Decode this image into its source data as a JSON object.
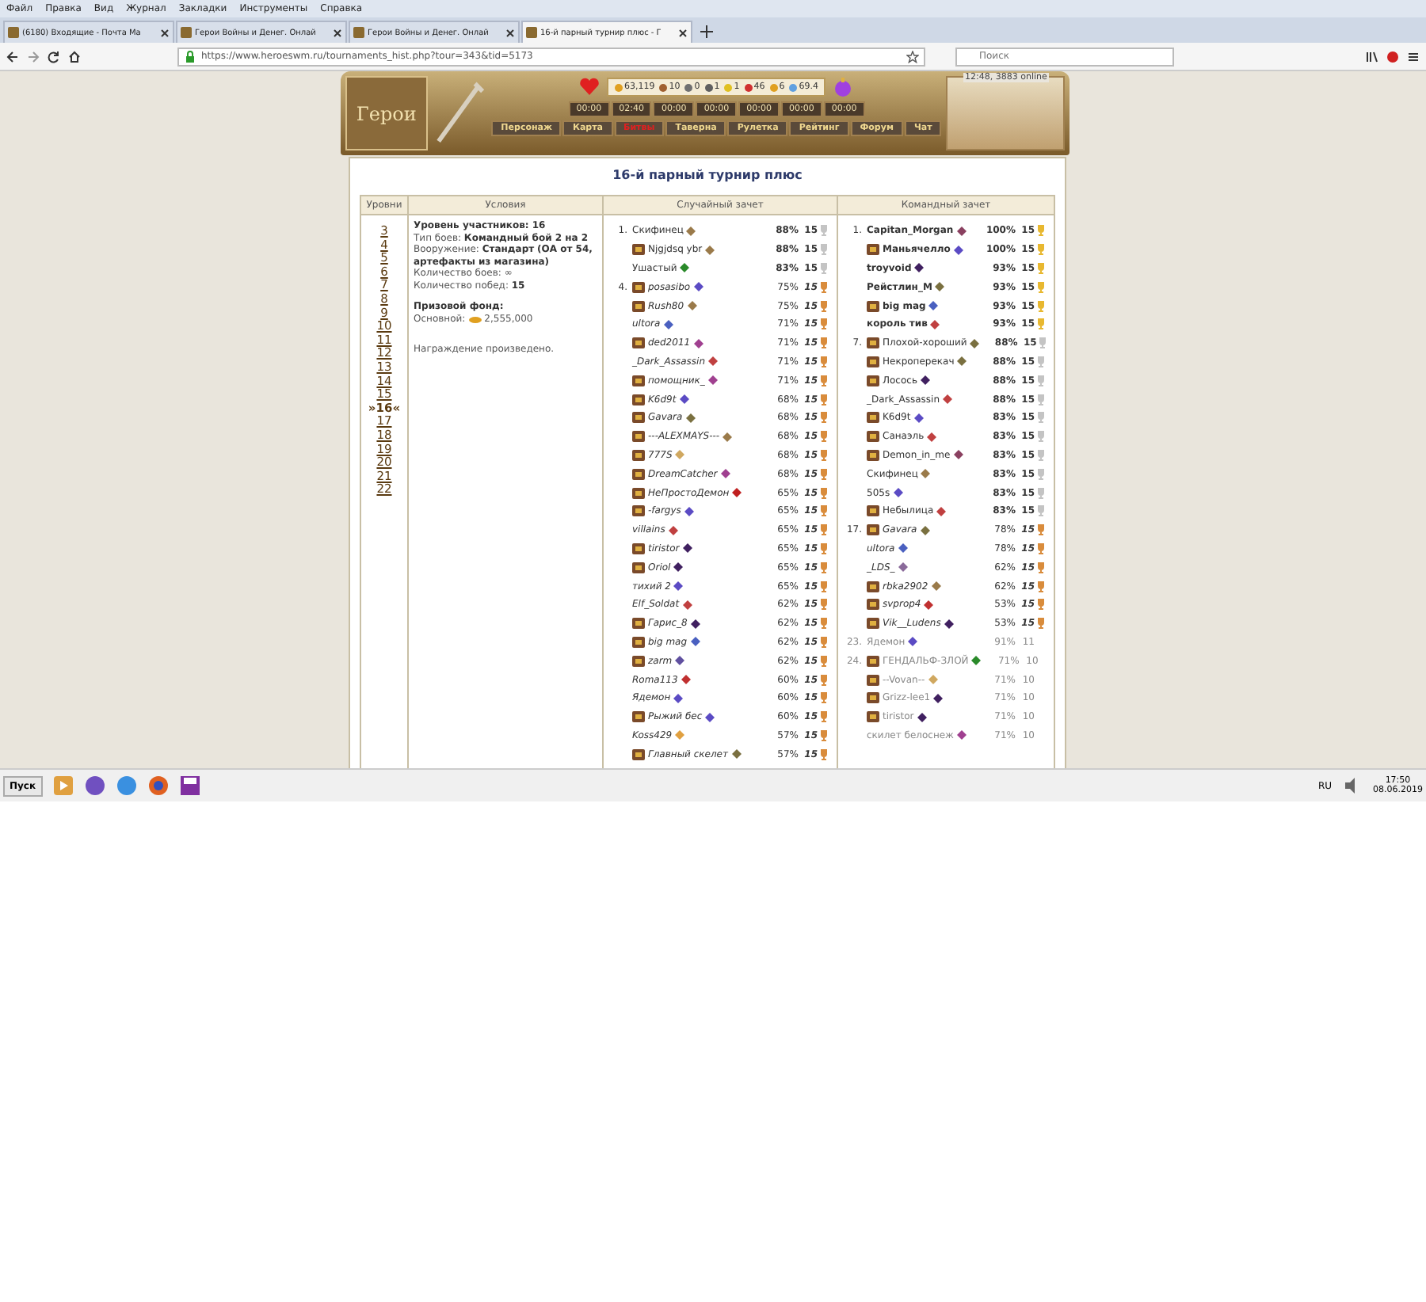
{
  "browser": {
    "menu": [
      "Файл",
      "Правка",
      "Вид",
      "Журнал",
      "Закладки",
      "Инструменты",
      "Справка"
    ],
    "tabs": [
      {
        "title": "(6180) Входящие - Почта Ма",
        "selected": false
      },
      {
        "title": "Герои Войны и Денег. Онлай",
        "selected": false
      },
      {
        "title": "Герои Войны и Денег. Онлай",
        "selected": false
      },
      {
        "title": "16-й парный турнир плюс - Г",
        "selected": true
      }
    ],
    "url": "https://www.heroeswm.ru/tournaments_hist.php?tour=343&tid=5173",
    "search": {
      "placeholder": "Поиск"
    }
  },
  "header": {
    "logo": "Герои",
    "online": "12:48, 3883 online",
    "stats": [
      "63,119",
      "10",
      "0",
      "1",
      "1",
      "46",
      "6",
      "69.4"
    ],
    "timers": [
      "00:00",
      "02:40",
      "00:00",
      "00:00",
      "00:00",
      "00:00",
      "00:00"
    ],
    "nav": [
      {
        "label": "Персонаж",
        "selected": false
      },
      {
        "label": "Карта",
        "selected": false
      },
      {
        "label": "Битвы",
        "selected": true
      },
      {
        "label": "Таверна",
        "selected": false
      },
      {
        "label": "Рулетка",
        "selected": false
      },
      {
        "label": "Рейтинг",
        "selected": false
      },
      {
        "label": "Форум",
        "selected": false
      },
      {
        "label": "Чат",
        "selected": false
      }
    ]
  },
  "title": "16-й парный турнир плюс",
  "table": {
    "columns": [
      "Уровни",
      "Условия",
      "Случайный зачет",
      "Командный зачет"
    ],
    "levels": [
      {
        "label": "3",
        "selected": false
      },
      {
        "label": "4",
        "selected": false
      },
      {
        "label": "5",
        "selected": false
      },
      {
        "label": "6",
        "selected": false
      },
      {
        "label": "7",
        "selected": false
      },
      {
        "label": "8",
        "selected": false
      },
      {
        "label": "9",
        "selected": false
      },
      {
        "label": "10",
        "selected": false
      },
      {
        "label": "11",
        "selected": false
      },
      {
        "label": "12",
        "selected": false
      },
      {
        "label": "13",
        "selected": false
      },
      {
        "label": "14",
        "selected": false
      },
      {
        "label": "15",
        "selected": false
      },
      {
        "label": "»16«",
        "selected": true
      },
      {
        "label": "17",
        "selected": false
      },
      {
        "label": "18",
        "selected": false
      },
      {
        "label": "19",
        "selected": false
      },
      {
        "label": "20",
        "selected": false
      },
      {
        "label": "21",
        "selected": false
      },
      {
        "label": "22",
        "selected": false
      }
    ],
    "conditions": [
      "**Уровень участников: 16**",
      "Тип боев: **Командный бой 2 на 2**",
      "Вооружение: **Стандарт** **(ОА от 54, артефакты из магазина)**",
      "Количество боев: ∞",
      "Количество побед: **15**"
    ],
    "prize_title": "Призовой фонд:",
    "prize_label": "Основной:",
    "prize_amount": "2,555,000",
    "note": "Награждение произведено.",
    "random": [
      {
        "place": "1.",
        "name": "Скифинец",
        "emblem": false,
        "color": "#9a7a4a",
        "percent": "88%",
        "wins": "15",
        "kind": "silver"
      },
      {
        "name": "Njgjdsq ybr",
        "emblem": true,
        "color": "#9a7a4a",
        "percent": "88%",
        "wins": "15",
        "kind": "silver"
      },
      {
        "name": "Ушастый",
        "emblem": false,
        "color": "#2a8a2a",
        "percent": "83%",
        "wins": "15",
        "kind": "silver"
      },
      {
        "place": "4.",
        "name": "posasibo",
        "emblem": true,
        "color": "#5b4bc4",
        "percent": "75%",
        "wins": "15",
        "kind": "bronze"
      },
      {
        "name": "Rush80",
        "emblem": true,
        "color": "#9a7a4a",
        "percent": "75%",
        "wins": "15",
        "kind": "bronze"
      },
      {
        "name": "ultora",
        "emblem": false,
        "color": "#4a60c0",
        "percent": "71%",
        "wins": "15",
        "kind": "bronze"
      },
      {
        "name": "ded2011",
        "emblem": true,
        "color": "#a04090",
        "percent": "71%",
        "wins": "15",
        "kind": "bronze"
      },
      {
        "name": "_Dark_Assassin",
        "emblem": false,
        "color": "#c04040",
        "percent": "71%",
        "wins": "15",
        "kind": "bronze"
      },
      {
        "name": "помощник_",
        "emblem": true,
        "color": "#a04090",
        "percent": "71%",
        "wins": "15",
        "kind": "bronze"
      },
      {
        "name": "K6d9t",
        "emblem": true,
        "color": "#5b4bc4",
        "percent": "68%",
        "wins": "15",
        "kind": "bronze"
      },
      {
        "name": "Gavara",
        "emblem": true,
        "color": "#7a7040",
        "percent": "68%",
        "wins": "15",
        "kind": "bronze"
      },
      {
        "name": "---ALEXMAYS---",
        "emblem": true,
        "color": "#9a7a4a",
        "percent": "68%",
        "wins": "15",
        "kind": "bronze"
      },
      {
        "name": "777S",
        "emblem": true,
        "color": "#d0a860",
        "percent": "68%",
        "wins": "15",
        "kind": "bronze"
      },
      {
        "name": "DreamCatcher",
        "emblem": true,
        "color": "#a04090",
        "percent": "68%",
        "wins": "15",
        "kind": "bronze"
      },
      {
        "name": "НеПростоДемон",
        "emblem": true,
        "color": "#c02020",
        "percent": "65%",
        "wins": "15",
        "kind": "bronze"
      },
      {
        "name": "-fargys",
        "emblem": true,
        "color": "#5b4bc4",
        "percent": "65%",
        "wins": "15",
        "kind": "bronze"
      },
      {
        "name": "villains",
        "emblem": false,
        "color": "#c04040",
        "percent": "65%",
        "wins": "15",
        "kind": "bronze"
      },
      {
        "name": "tiristor",
        "emblem": true,
        "color": "#402060",
        "percent": "65%",
        "wins": "15",
        "kind": "bronze"
      },
      {
        "name": "Oriol",
        "emblem": true,
        "color": "#402060",
        "percent": "65%",
        "wins": "15",
        "kind": "bronze"
      },
      {
        "name": "тихий 2",
        "emblem": false,
        "color": "#5b4bc4",
        "percent": "65%",
        "wins": "15",
        "kind": "bronze"
      },
      {
        "name": "Elf_Soldat",
        "emblem": false,
        "color": "#c04040",
        "percent": "62%",
        "wins": "15",
        "kind": "bronze"
      },
      {
        "name": "Гарис_8",
        "emblem": true,
        "color": "#402060",
        "percent": "62%",
        "wins": "15",
        "kind": "bronze"
      },
      {
        "name": "big mag",
        "emblem": true,
        "color": "#4a60c0",
        "percent": "62%",
        "wins": "15",
        "kind": "bronze"
      },
      {
        "name": "zarm",
        "emblem": true,
        "color": "#6050a0",
        "percent": "62%",
        "wins": "15",
        "kind": "bronze"
      },
      {
        "name": "Roma113",
        "emblem": false,
        "color": "#c03030",
        "percent": "60%",
        "wins": "15",
        "kind": "bronze"
      },
      {
        "name": "Ядемон",
        "emblem": false,
        "color": "#5b4bc4",
        "percent": "60%",
        "wins": "15",
        "kind": "bronze"
      },
      {
        "name": "Рыжий бес",
        "emblem": true,
        "color": "#5b4bc4",
        "percent": "60%",
        "wins": "15",
        "kind": "bronze"
      },
      {
        "name": "Koss429",
        "emblem": false,
        "color": "#e0a040",
        "percent": "57%",
        "wins": "15",
        "kind": "bronze"
      },
      {
        "name": "Главный скелет",
        "emblem": true,
        "color": "#7a7040",
        "percent": "57%",
        "wins": "15",
        "kind": "bronze"
      }
    ],
    "team": [
      {
        "place": "1.",
        "name": "Capitan_Morgan",
        "emblem": false,
        "color": "#8a4060",
        "percent": "100%",
        "wins": "15",
        "kind": "gold"
      },
      {
        "name": "Маньячелло",
        "emblem": true,
        "color": "#5b4bc4",
        "percent": "100%",
        "wins": "15",
        "kind": "gold"
      },
      {
        "name": "troyvoid",
        "emblem": false,
        "color": "#402060",
        "percent": "93%",
        "wins": "15",
        "kind": "gold"
      },
      {
        "name": "Рейстлин_М",
        "emblem": false,
        "color": "#7a7040",
        "percent": "93%",
        "wins": "15",
        "kind": "gold"
      },
      {
        "name": "big mag",
        "emblem": true,
        "color": "#4a60c0",
        "percent": "93%",
        "wins": "15",
        "kind": "gold"
      },
      {
        "name": "король тив",
        "emblem": false,
        "color": "#c04040",
        "percent": "93%",
        "wins": "15",
        "kind": "gold"
      },
      {
        "place": "7.",
        "name": "Плохой-хороший",
        "emblem": true,
        "color": "#7a7040",
        "percent": "88%",
        "wins": "15",
        "kind": "silver"
      },
      {
        "name": "Некроперекач",
        "emblem": true,
        "color": "#7a7040",
        "percent": "88%",
        "wins": "15",
        "kind": "silver"
      },
      {
        "name": "Лосось",
        "emblem": true,
        "color": "#402060",
        "percent": "88%",
        "wins": "15",
        "kind": "silver"
      },
      {
        "name": "_Dark_Assassin",
        "emblem": false,
        "color": "#c04040",
        "percent": "88%",
        "wins": "15",
        "kind": "silver"
      },
      {
        "name": "K6d9t",
        "emblem": true,
        "color": "#5b4bc4",
        "percent": "83%",
        "wins": "15",
        "kind": "silver"
      },
      {
        "name": "Санаэль",
        "emblem": true,
        "color": "#c04040",
        "percent": "83%",
        "wins": "15",
        "kind": "silver"
      },
      {
        "name": "Demon_in_me",
        "emblem": true,
        "color": "#8a4060",
        "percent": "83%",
        "wins": "15",
        "kind": "silver"
      },
      {
        "name": "Скифинец",
        "emblem": false,
        "color": "#9a7a4a",
        "percent": "83%",
        "wins": "15",
        "kind": "silver"
      },
      {
        "name": "505s",
        "emblem": false,
        "color": "#5b4bc4",
        "percent": "83%",
        "wins": "15",
        "kind": "silver"
      },
      {
        "name": "Небылица",
        "emblem": true,
        "color": "#c04040",
        "percent": "83%",
        "wins": "15",
        "kind": "silver"
      },
      {
        "place": "17.",
        "name": "Gavara",
        "emblem": true,
        "color": "#7a7040",
        "percent": "78%",
        "wins": "15",
        "kind": "bronze"
      },
      {
        "name": "ultora",
        "emblem": false,
        "color": "#4a60c0",
        "percent": "78%",
        "wins": "15",
        "kind": "bronze"
      },
      {
        "name": "_LDS_",
        "emblem": false,
        "color": "#8a6a9a",
        "percent": "62%",
        "wins": "15",
        "kind": "bronze"
      },
      {
        "name": "rbka2902",
        "emblem": true,
        "color": "#9a7a4a",
        "percent": "62%",
        "wins": "15",
        "kind": "bronze"
      },
      {
        "name": "svprop4",
        "emblem": true,
        "color": "#c03030",
        "percent": "53%",
        "wins": "15",
        "kind": "bronze"
      },
      {
        "name": "Vik__Ludens",
        "emblem": true,
        "color": "#402060",
        "percent": "53%",
        "wins": "15",
        "kind": "bronze"
      },
      {
        "place": "23.",
        "name": "Ядемон",
        "emblem": false,
        "color": "#5b4bc4",
        "percent": "91%",
        "wins": "11",
        "kind": "unplaced"
      },
      {
        "place": "24.",
        "name": "ГЕНДАЛЬФ-ЗЛОЙ",
        "emblem": true,
        "color": "#2a8a2a",
        "percent": "71%",
        "wins": "10",
        "kind": "unplaced"
      },
      {
        "name": "--Vovan--",
        "emblem": true,
        "color": "#d0a860",
        "percent": "71%",
        "wins": "10",
        "kind": "unplaced"
      },
      {
        "name": "Grizz-lee1",
        "emblem": true,
        "color": "#402060",
        "percent": "71%",
        "wins": "10",
        "kind": "unplaced"
      },
      {
        "name": "tiristor",
        "emblem": true,
        "color": "#402060",
        "percent": "71%",
        "wins": "10",
        "kind": "unplaced"
      },
      {
        "name": "скилет белоснеж",
        "emblem": false,
        "color": "#a04090",
        "percent": "71%",
        "wins": "10",
        "kind": "unplaced"
      }
    ]
  },
  "taskbar": {
    "start": "Пуск",
    "lang": "RU",
    "time": "17:50",
    "date": "08.06.2019"
  }
}
